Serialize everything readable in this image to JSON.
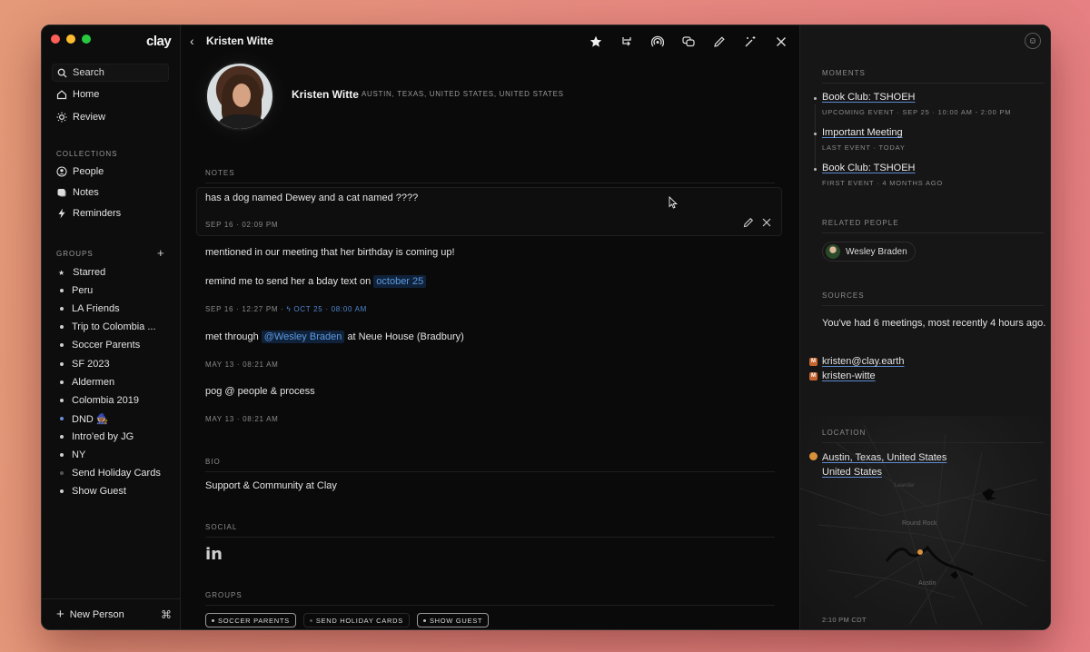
{
  "sidebar": {
    "logo": "clay",
    "search_label": "Search",
    "nav": [
      {
        "label": "Home",
        "icon": "home-icon"
      },
      {
        "label": "Review",
        "icon": "sun-icon"
      }
    ],
    "collections_label": "COLLECTIONS",
    "collections": [
      {
        "label": "People",
        "icon": "person-icon"
      },
      {
        "label": "Notes",
        "icon": "notes-icon"
      },
      {
        "label": "Reminders",
        "icon": "bolt-icon"
      }
    ],
    "groups_label": "GROUPS",
    "groups_add": "+",
    "groups": [
      {
        "label": "Starred",
        "marker": "star"
      },
      {
        "label": "Peru",
        "marker": "dot"
      },
      {
        "label": "LA Friends",
        "marker": "dot"
      },
      {
        "label": "Trip to Colombia ...",
        "marker": "dot"
      },
      {
        "label": "Soccer Parents",
        "marker": "dot"
      },
      {
        "label": "SF 2023",
        "marker": "dot"
      },
      {
        "label": "Aldermen",
        "marker": "dot"
      },
      {
        "label": "Colombia 2019",
        "marker": "dot"
      },
      {
        "label": "DND 🧙🏾",
        "marker": "blue-dot"
      },
      {
        "label": "Intro'ed by JG",
        "marker": "dot"
      },
      {
        "label": "NY",
        "marker": "dot"
      },
      {
        "label": "Send Holiday Cards",
        "marker": "dim-dot"
      },
      {
        "label": "Show Guest",
        "marker": "dot"
      }
    ],
    "new_person_label": "New Person",
    "command_glyph": "⌘"
  },
  "header": {
    "back_glyph": "‹",
    "title": "Kristen Witte",
    "toolbar_icons": [
      "star-icon",
      "merge-icon",
      "broadcast-icon",
      "chat-icon",
      "pencil-icon",
      "magic-icon",
      "close-icon"
    ]
  },
  "profile": {
    "name": "Kristen Witte",
    "location": "AUSTIN, TEXAS, UNITED STATES, UNITED STATES"
  },
  "notes": {
    "label": "NOTES",
    "items": [
      {
        "text": "has a dog named Dewey and a cat named ????",
        "meta": "SEP 16 · 02:09 PM"
      },
      {
        "text": "mentioned in our meeting that her birthday is coming up!"
      },
      {
        "text_before": "remind me to send her a bday text on",
        "link": "october 25",
        "meta": "SEP 16 · 12:27 PM ·",
        "meta_reminder": "OCT 25 · 08:00 AM"
      },
      {
        "text_before": "met through",
        "link": "@Wesley Braden",
        "text_after": "at Neue House (Bradbury)",
        "meta": "MAY 13 · 08:21 AM"
      },
      {
        "text": "pog @ people & process",
        "meta": "MAY 13 · 08:21 AM"
      }
    ]
  },
  "bio": {
    "label": "BIO",
    "text": "Support & Community at Clay"
  },
  "social": {
    "label": "SOCIAL",
    "linkedin": "in"
  },
  "groups_section": {
    "label": "GROUPS",
    "tags": [
      "SOCCER PARENTS",
      "SEND HOLIDAY CARDS",
      "SHOW GUEST"
    ]
  },
  "right_panel": {
    "moments_label": "MOMENTS",
    "moments": [
      {
        "title": "Book Club: TSHOEH",
        "sub": "UPCOMING EVENT · SEP 25 · 10:00 AM - 2:00 PM"
      },
      {
        "title": "Important Meeting",
        "sub": "LAST EVENT · TODAY"
      },
      {
        "title": "Book Club: TSHOEH",
        "sub": "FIRST EVENT · 4 MONTHS AGO"
      }
    ],
    "related_label": "RELATED PEOPLE",
    "related_person": "Wesley Braden",
    "sources_label": "SOURCES",
    "sources_text": "You've had 6 meetings, most recently 4 hours ago.",
    "sources": [
      "kristen@clay.earth",
      "kristen-witte"
    ],
    "location_label": "LOCATION",
    "location_line1": "Austin, Texas, United States",
    "location_line2": "United States",
    "map_labels": {
      "round_rock": "Round Rock",
      "austin": "Austin",
      "leander": "Leander"
    },
    "map_time": "2:10 PM CDT"
  },
  "colors": {
    "accent_blue": "#5c99e0",
    "map_pin": "#d9913a",
    "source_badge": "#c7652f"
  }
}
